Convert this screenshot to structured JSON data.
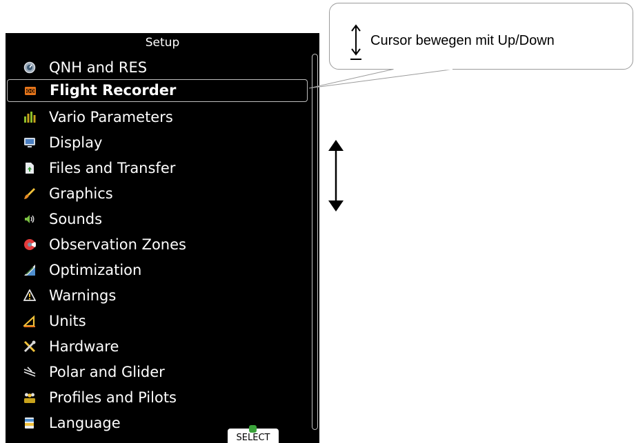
{
  "screen": {
    "title": "Setup",
    "menu": [
      {
        "label": "QNH and RES",
        "icon": "gauge-icon"
      },
      {
        "label": "Flight Recorder",
        "icon": "recorder-icon",
        "selected": true
      },
      {
        "label": "Vario Parameters",
        "icon": "equalizer-icon"
      },
      {
        "label": "Display",
        "icon": "monitor-icon"
      },
      {
        "label": "Files and Transfer",
        "icon": "file-transfer-icon"
      },
      {
        "label": "Graphics",
        "icon": "brush-icon"
      },
      {
        "label": "Sounds",
        "icon": "speaker-icon"
      },
      {
        "label": "Observation Zones",
        "icon": "zone-icon"
      },
      {
        "label": "Optimization",
        "icon": "optimization-icon"
      },
      {
        "label": "Warnings",
        "icon": "warning-icon"
      },
      {
        "label": "Units",
        "icon": "units-icon"
      },
      {
        "label": "Hardware",
        "icon": "tools-icon"
      },
      {
        "label": "Polar and Glider",
        "icon": "glider-icon"
      },
      {
        "label": "Profiles and Pilots",
        "icon": "pilots-icon"
      },
      {
        "label": "Language",
        "icon": "language-icon"
      }
    ],
    "select_button": {
      "label": "SELECT",
      "icon": "check-icon"
    }
  },
  "callout": {
    "text": "Cursor bewegen mit Up/Down",
    "icon": "up-down-arrow-icon"
  }
}
